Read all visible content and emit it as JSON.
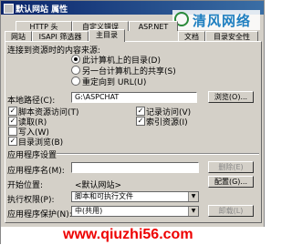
{
  "window": {
    "title": "默认网站 属性"
  },
  "logo": {
    "text": "清风网络"
  },
  "tabs_row1": [
    "HTTP 头",
    "自定义错误",
    "ASP.NET"
  ],
  "tabs_row2": [
    "网站",
    "ISAPI 筛选器",
    "主目录",
    "文档",
    "目录安全性"
  ],
  "active_tab": "主目录",
  "content_source": {
    "label": "连接到资源时的内容来源:",
    "options": [
      "此计算机上的目录(D)",
      "另一台计算机上的共享(S)",
      "重定向到 URL(U)"
    ],
    "selected": 0
  },
  "local_path": {
    "label": "本地路径(C):",
    "value": "G:\\ASPCHAT",
    "browse_label": "浏览(O)..."
  },
  "checkboxes_left": [
    {
      "label": "脚本资源访问(T)",
      "checked": true
    },
    {
      "label": "读取(R)",
      "checked": true
    },
    {
      "label": "写入(W)",
      "checked": false
    },
    {
      "label": "目录浏览(B)",
      "checked": true
    }
  ],
  "checkboxes_right": [
    {
      "label": "记录访问(V)",
      "checked": true
    },
    {
      "label": "索引资源(I)",
      "checked": true
    }
  ],
  "app_settings": {
    "heading": "应用程序设置",
    "name_label": "应用程序名(M):",
    "remove_label": "删除(E)",
    "start_label": "开始位置:",
    "start_value": "<默认网站>",
    "config_label": "配置(G)...",
    "exec_label": "执行权限(P):",
    "exec_value": "脚本和可执行文件",
    "protect_label": "应用程序保护(N):",
    "protect_value": "中(共用)",
    "unload_label": "卸载(L)"
  },
  "watermark": {
    "text": "www.qiuzhi56.com"
  }
}
